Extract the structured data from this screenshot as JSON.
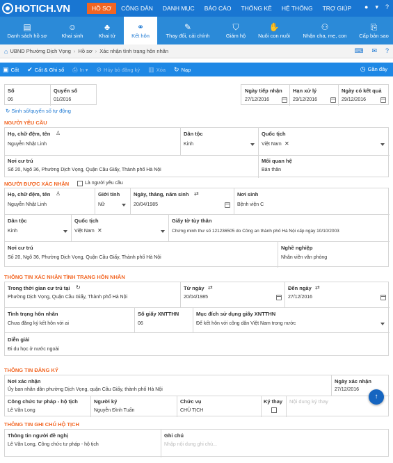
{
  "app": {
    "logo": "HOTICH.VN"
  },
  "topnav": [
    "HỒ SƠ",
    "CÔNG DÂN",
    "DANH MỤC",
    "BÁO CÁO",
    "THỐNG KÊ",
    "HỆ THỐNG",
    "TRỢ GIÚP"
  ],
  "topright": {
    "user_icon": "user-icon",
    "caret": "▾",
    "help": "?"
  },
  "iconbar": [
    "Danh sách hồ sơ",
    "Khai sinh",
    "Khai tử",
    "Kết hôn",
    "Thay đổi, cải chính",
    "Giám hộ",
    "Nuôi con nuôi",
    "Nhận cha, mẹ, con",
    "Cấp bản sao"
  ],
  "breadcrumb": [
    "UBND Phường Dịch Vọng",
    "Hồ sơ",
    "Xác nhận tình trạng hôn nhân"
  ],
  "toolbar": {
    "save": "Cất",
    "save_close": "Cất & Ghi sổ",
    "print": "In",
    "cancel_reg": "Hủy bỏ đăng ký",
    "delete": "Xóa",
    "reload": "Nạp",
    "recent": "Gần đây"
  },
  "header": {
    "so_label": "Số",
    "so": "06",
    "quyen_label": "Quyển số",
    "quyen": "01/2016",
    "auto_link": "Sinh số/quyển số tự động",
    "ngay_tiep_nhan_label": "Ngày tiếp nhận",
    "ngay_tiep_nhan": "27/12/2016",
    "han_xu_ly_label": "Hạn xử lý",
    "han_xu_ly": "29/12/2016",
    "ngay_co_kq_label": "Ngày có kết quả",
    "ngay_co_kq": "29/12/2016"
  },
  "nguoi_yeu_cau": {
    "title": "NGƯỜI YÊU CẦU",
    "ho_ten_label": "Họ, chữ đệm, tên",
    "ho_ten": "Nguyễn Nhật Linh",
    "dan_toc_label": "Dân tộc",
    "dan_toc": "Kinh",
    "quoc_tich_label": "Quốc tịch",
    "quoc_tich": "Việt Nam",
    "noi_cu_tru_label": "Nơi cư trú",
    "noi_cu_tru": "Số 20, Ngõ 36, Phường Dịch Vọng, Quận Cầu Giấy, Thành phố Hà Nội",
    "quan_he_label": "Mối quan hệ",
    "quan_he": "Bản thân"
  },
  "nguoi_xac_nhan": {
    "title": "NGƯỜI ĐƯỢC XÁC NHẬN",
    "same_label": "Là người yêu cầu",
    "ho_ten_label": "Họ, chữ đệm, tên",
    "ho_ten": "Nguyễn Nhật Linh",
    "gioi_tinh_label": "Giới tính",
    "gioi_tinh": "Nữ",
    "ngay_sinh_label": "Ngày, tháng, năm sinh",
    "ngay_sinh": "20/04/1985",
    "noi_sinh_label": "Nơi sinh",
    "noi_sinh": "Bệnh viện C",
    "dan_toc_label": "Dân tộc",
    "dan_toc": "Kinh",
    "quoc_tich_label": "Quốc tịch",
    "quoc_tich": "Việt Nam",
    "giay_to_label": "Giấy tờ tùy thân",
    "giay_to": "Chứng minh thư số 121236505 do Công an thành phố Hà Nội cấp ngày 10/10/2003",
    "noi_cu_tru_label": "Nơi cư trú",
    "noi_cu_tru": "Số 20, Ngõ 36, Phường Dịch Vọng, Quận Cầu Giấy, Thành phố Hà Nội",
    "nghe_label": "Nghề nghiệp",
    "nghe": "Nhân viên văn phòng"
  },
  "tinh_trang": {
    "title": "THÔNG TIN XÁC NHẬN TÌNH TRẠNG HÔN NHÂN",
    "thoi_gian_label": "Trong thời gian cư trú tại",
    "thoi_gian": "Phường Dịch Vọng, Quận Cầu Giấy, Thành phố Hà Nội",
    "tu_ngay_label": "Từ ngày",
    "tu_ngay": "20/04/1985",
    "den_ngay_label": "Đến ngày",
    "den_ngay": "27/12/2016",
    "tinh_trang_label": "Tình trạng hôn nhân",
    "tinh_trang": "Chưa đăng ký kết hôn với ai",
    "so_giay_label": "Số giấy XNTTHN",
    "so_giay": "06",
    "muc_dich_label": "Mục đích sử dụng giấy XNTTHN",
    "muc_dich": "Để kết hôn với công dân Việt Nam trong nước",
    "dien_giai_label": "Diễn giải",
    "dien_giai": "Đi du học ở nước ngoài"
  },
  "dang_ky": {
    "title": "THÔNG TIN ĐĂNG KÝ",
    "noi_xn_label": "Nơi xác nhận",
    "noi_xn": "Ủy ban nhân dân phường Dịch Vọng, quận Cầu Giấy, thành phố Hà Nội",
    "ngay_xn_label": "Ngày xác nhận",
    "ngay_xn": "27/12/2016",
    "cong_chuc_label": "Công chức tư pháp - hộ tịch",
    "cong_chuc": "Lê Văn Long",
    "nguoi_ky_label": "Người ký",
    "nguoi_ky": "Nguyễn Đình Tuấn",
    "chuc_vu_label": "Chức vụ",
    "chuc_vu": "CHỦ TỊCH",
    "ky_thay_label": "Ký thay",
    "noi_dung_label": "Nội dung ký thay"
  },
  "ghi_chu": {
    "title": "THÔNG TIN GHI CHÚ HỘ TỊCH",
    "nguoi_de_nghi_label": "Thông tin người đề nghị",
    "nguoi_de_nghi": "Lê Văn Long, Công chức tư pháp - hộ tịch",
    "ghi_chu_label": "Ghi chú",
    "ghi_chu_placeholder": "Nhập nội dung ghi chú..."
  }
}
